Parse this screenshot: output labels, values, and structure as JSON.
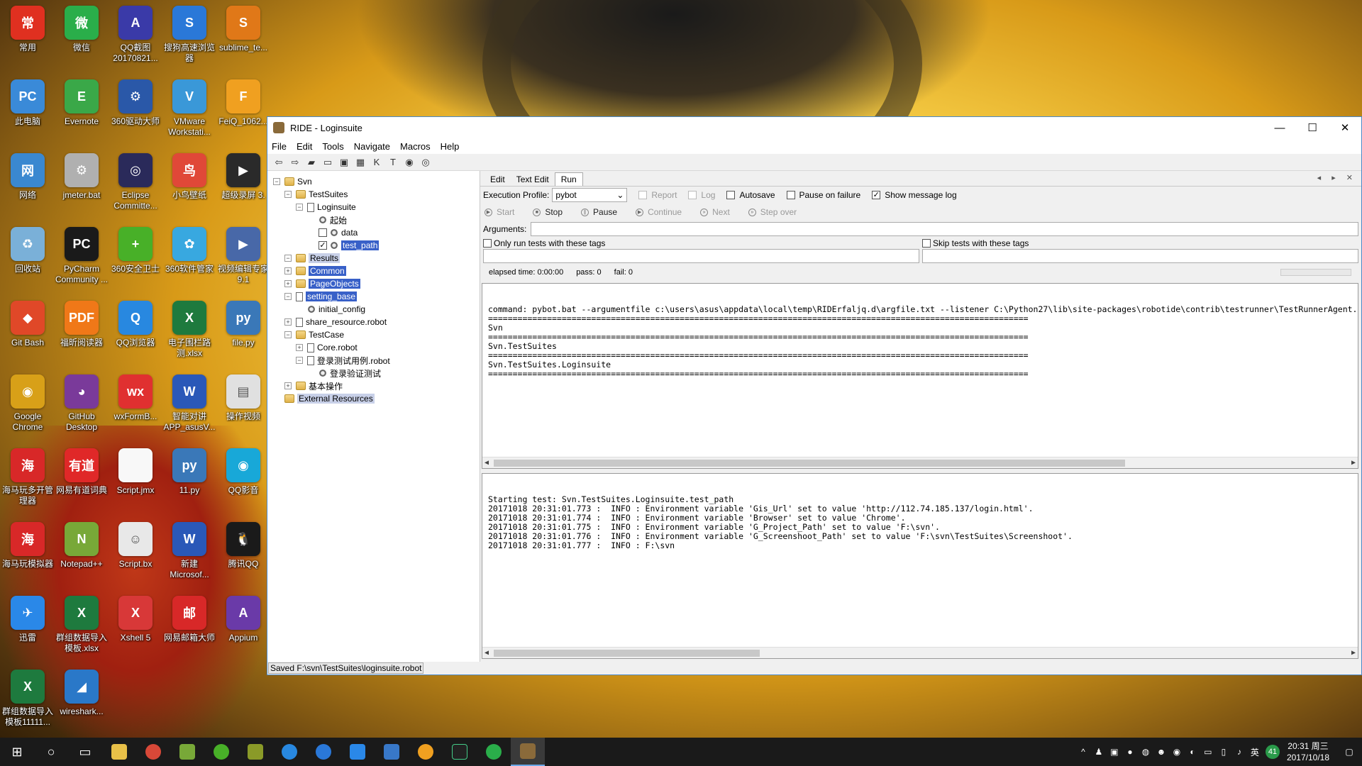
{
  "desktop": {
    "icons": [
      {
        "label": "常用",
        "color": "#e03020",
        "glyph": "常",
        "icon": "folder-icon"
      },
      {
        "label": "微信",
        "color": "#2aae4a",
        "glyph": "微",
        "icon": "wechat-icon"
      },
      {
        "label": "QQ截图 20170821...",
        "color": "#3a3aa8",
        "glyph": "A",
        "icon": "appium-icon"
      },
      {
        "label": "搜狗高速浏览器",
        "color": "#2a78d8",
        "glyph": "S",
        "icon": "sogou-browser-icon"
      },
      {
        "label": "sublime_te...",
        "color": "#e07818",
        "glyph": "S",
        "icon": "sublime-icon"
      },
      {
        "label": "此电脑",
        "color": "#3a8ad8",
        "glyph": "PC",
        "icon": "computer-icon"
      },
      {
        "label": "Evernote",
        "color": "#3aa848",
        "glyph": "E",
        "icon": "evernote-icon"
      },
      {
        "label": "360驱动大师",
        "color": "#2a58a8",
        "glyph": "⚙",
        "icon": "driver-icon"
      },
      {
        "label": "VMware Workstati...",
        "color": "#3a98d8",
        "glyph": "V",
        "icon": "vmware-icon"
      },
      {
        "label": "FeiQ_1062...",
        "color": "#f0a020",
        "glyph": "F",
        "icon": "feiq-icon"
      },
      {
        "label": "网络",
        "color": "#3a88d0",
        "glyph": "网",
        "icon": "network-icon"
      },
      {
        "label": "jmeter.bat",
        "color": "#b0b0b0",
        "glyph": "⚙",
        "icon": "bat-file-icon"
      },
      {
        "label": "Eclipse Committe...",
        "color": "#2a2a5a",
        "glyph": "◎",
        "icon": "eclipse-icon"
      },
      {
        "label": "小鸟壁纸",
        "color": "#e04838",
        "glyph": "鸟",
        "icon": "wallpaper-icon"
      },
      {
        "label": "超级录屏 3.",
        "color": "#2a2a2a",
        "glyph": "▶",
        "icon": "recorder-icon"
      },
      {
        "label": "回收站",
        "color": "#7ab0d8",
        "glyph": "♻",
        "icon": "recycle-bin-icon"
      },
      {
        "label": "PyCharm Community ...",
        "color": "#1a1a1a",
        "glyph": "PC",
        "icon": "pycharm-icon"
      },
      {
        "label": "360安全卫士",
        "color": "#48b028",
        "glyph": "+",
        "icon": "security-icon"
      },
      {
        "label": "360软件管家",
        "color": "#38a8e0",
        "glyph": "✿",
        "icon": "software-manager-icon"
      },
      {
        "label": "视频编辑专家 9.1",
        "color": "#4868a8",
        "glyph": "▶",
        "icon": "video-editor-icon"
      },
      {
        "label": "Git Bash",
        "color": "#e04828",
        "glyph": "◆",
        "icon": "git-bash-icon"
      },
      {
        "label": "福昕阅读器",
        "color": "#f07818",
        "glyph": "PDF",
        "icon": "pdf-reader-icon"
      },
      {
        "label": "QQ浏览器",
        "color": "#2888e0",
        "glyph": "Q",
        "icon": "qq-browser-icon"
      },
      {
        "label": "电子围栏路测.xlsx",
        "color": "#1e7a3e",
        "glyph": "X",
        "icon": "excel-file-icon"
      },
      {
        "label": "file.py",
        "color": "#3a78b8",
        "glyph": "py",
        "icon": "python-file-icon"
      },
      {
        "label": "Google Chrome",
        "color": "#d8a018",
        "glyph": "◉",
        "icon": "chrome-icon"
      },
      {
        "label": "GitHub Desktop",
        "color": "#7a3a9a",
        "glyph": "◕",
        "icon": "github-icon"
      },
      {
        "label": "wxFormB...",
        "color": "#e03030",
        "glyph": "wx",
        "icon": "wxformbuilder-icon"
      },
      {
        "label": "智能对讲 APP_asusV...",
        "color": "#2a58b8",
        "glyph": "W",
        "icon": "word-file-icon"
      },
      {
        "label": "操作视频",
        "color": "#e0e0e0",
        "glyph": "▤",
        "icon": "folder-icon"
      },
      {
        "label": "海马玩多开管理器",
        "color": "#d82828",
        "glyph": "海",
        "icon": "emulator-manager-icon"
      },
      {
        "label": "网易有道词典",
        "color": "#e02828",
        "glyph": "有道",
        "icon": "youdao-icon"
      },
      {
        "label": "Script.jmx",
        "color": "#f8f8f8",
        "glyph": "",
        "icon": "file-icon"
      },
      {
        "label": "11.py",
        "color": "#3a78b8",
        "glyph": "py",
        "icon": "python-file-icon"
      },
      {
        "label": "QQ影音",
        "color": "#18a8d8",
        "glyph": "◉",
        "icon": "qq-player-icon"
      },
      {
        "label": "海马玩模拟器",
        "color": "#d82828",
        "glyph": "海",
        "icon": "emulator-icon"
      },
      {
        "label": "Notepad++",
        "color": "#78a838",
        "glyph": "N",
        "icon": "notepad-icon"
      },
      {
        "label": "Script.bx",
        "color": "#e8e8e8",
        "glyph": "☺",
        "icon": "script-icon"
      },
      {
        "label": "新建 Microsof...",
        "color": "#2a58b8",
        "glyph": "W",
        "icon": "word-file-icon"
      },
      {
        "label": "腾讯QQ",
        "color": "#1a1a1a",
        "glyph": "🐧",
        "icon": "qq-icon"
      },
      {
        "label": "迅雷",
        "color": "#2a88e8",
        "glyph": "✈",
        "icon": "thunder-icon"
      },
      {
        "label": "群组数据导入模板.xlsx",
        "color": "#1e7a3e",
        "glyph": "X",
        "icon": "excel-file-icon"
      },
      {
        "label": "Xshell 5",
        "color": "#d83838",
        "glyph": "X",
        "icon": "xshell-icon"
      },
      {
        "label": "网易邮箱大师",
        "color": "#d82828",
        "glyph": "邮",
        "icon": "mail-icon"
      },
      {
        "label": "Appium",
        "color": "#6a3aa8",
        "glyph": "A",
        "icon": "appium-icon"
      },
      {
        "label": "群组数据导入模板11111...",
        "color": "#1e7a3e",
        "glyph": "X",
        "icon": "excel-file-icon"
      },
      {
        "label": "wireshark...",
        "color": "#2a78c8",
        "glyph": "◢",
        "icon": "wireshark-icon"
      }
    ]
  },
  "window": {
    "title": "RIDE - Loginsuite",
    "min": "—",
    "max": "☐",
    "close": "✕"
  },
  "menu": [
    "File",
    "Edit",
    "Tools",
    "Navigate",
    "Macros",
    "Help"
  ],
  "tree": [
    {
      "label": "Svn",
      "depth": 0,
      "exp": "⊟",
      "type": "folder"
    },
    {
      "label": "TestSuites",
      "depth": 1,
      "exp": "⊟",
      "type": "folder"
    },
    {
      "label": "Loginsuite",
      "depth": 2,
      "exp": "⊟",
      "type": "file"
    },
    {
      "label": "起始",
      "depth": 3,
      "exp": "",
      "type": "gear"
    },
    {
      "label": "data",
      "depth": 3,
      "exp": "",
      "type": "check"
    },
    {
      "label": "test_path",
      "depth": 3,
      "exp": "",
      "type": "check-on",
      "hl": true
    },
    {
      "label": "Results",
      "depth": 1,
      "exp": "⊟",
      "type": "folder",
      "hl2": true
    },
    {
      "label": "Common",
      "depth": 1,
      "exp": "⊞",
      "type": "folder",
      "hl": true
    },
    {
      "label": "PageObjects",
      "depth": 1,
      "exp": "⊞",
      "type": "folder",
      "hl": true
    },
    {
      "label": "setting_base",
      "depth": 1,
      "exp": "⊟",
      "type": "file",
      "hl": true
    },
    {
      "label": "initial_config",
      "depth": 2,
      "exp": "",
      "type": "gear"
    },
    {
      "label": "share_resource.robot",
      "depth": 1,
      "exp": "⊞",
      "type": "file"
    },
    {
      "label": "TestCase",
      "depth": 1,
      "exp": "⊟",
      "type": "folder"
    },
    {
      "label": "Core.robot",
      "depth": 2,
      "exp": "⊞",
      "type": "file"
    },
    {
      "label": "登录测试用例.robot",
      "depth": 2,
      "exp": "⊟",
      "type": "file"
    },
    {
      "label": "登录验证测试",
      "depth": 3,
      "exp": "",
      "type": "gear"
    },
    {
      "label": "基本操作",
      "depth": 1,
      "exp": "⊞",
      "type": "folder"
    },
    {
      "label": "External Resources",
      "depth": 0,
      "exp": "",
      "type": "folder",
      "hl2": true
    }
  ],
  "tabs": [
    "Edit",
    "Text Edit",
    "Run"
  ],
  "tabs_nav": "◂ ▸ ✕",
  "run": {
    "profile_label": "Execution Profile:",
    "profile_value": "pybot",
    "report": "Report",
    "log": "Log",
    "autosave": "Autosave",
    "pause_on_failure": "Pause on failure",
    "show_message_log": "Show message log",
    "start": "Start",
    "stop": "Stop",
    "pause": "Pause",
    "continue": "Continue",
    "next": "Next",
    "step_over": "Step over",
    "arguments_label": "Arguments:",
    "only_run_tags": "Only run tests with these tags",
    "skip_tags": "Skip tests with these tags",
    "elapsed": "elapsed time: 0:00:00",
    "pass": "pass: 0",
    "fail": "fail: 0"
  },
  "output_text": "command: pybot.bat --argumentfile c:\\users\\asus\\appdata\\local\\temp\\RIDErfaljq.d\\argfile.txt --listener C:\\Python27\\lib\\site-packages\\robotide\\contrib\\testrunner\\TestRunnerAgent.py\n==============================================================================================================\nSvn\n==============================================================================================================\nSvn.TestSuites\n==============================================================================================================\nSvn.TestSuites.Loginsuite\n==============================================================================================================",
  "log_text": "Starting test: Svn.TestSuites.Loginsuite.test_path\n20171018 20:31:01.773 :  INFO : Environment variable 'Gis_Url' set to value 'http://112.74.185.137/login.html'.\n20171018 20:31:01.774 :  INFO : Environment variable 'Browser' set to value 'Chrome'.\n20171018 20:31:01.775 :  INFO : Environment variable 'G_Project_Path' set to value 'F:\\svn'.\n20171018 20:31:01.776 :  INFO : Environment variable 'G_Screenshoot_Path' set to value 'F:\\svn\\TestSuites\\Screenshoot'.\n20171018 20:31:01.777 :  INFO : F:\\svn",
  "status": "Saved F:\\svn\\TestSuites\\loginsuite.robot",
  "taskbar": {
    "time": "20:31 周三",
    "date": "2017/10/18",
    "ime": "英",
    "badge": "41"
  }
}
